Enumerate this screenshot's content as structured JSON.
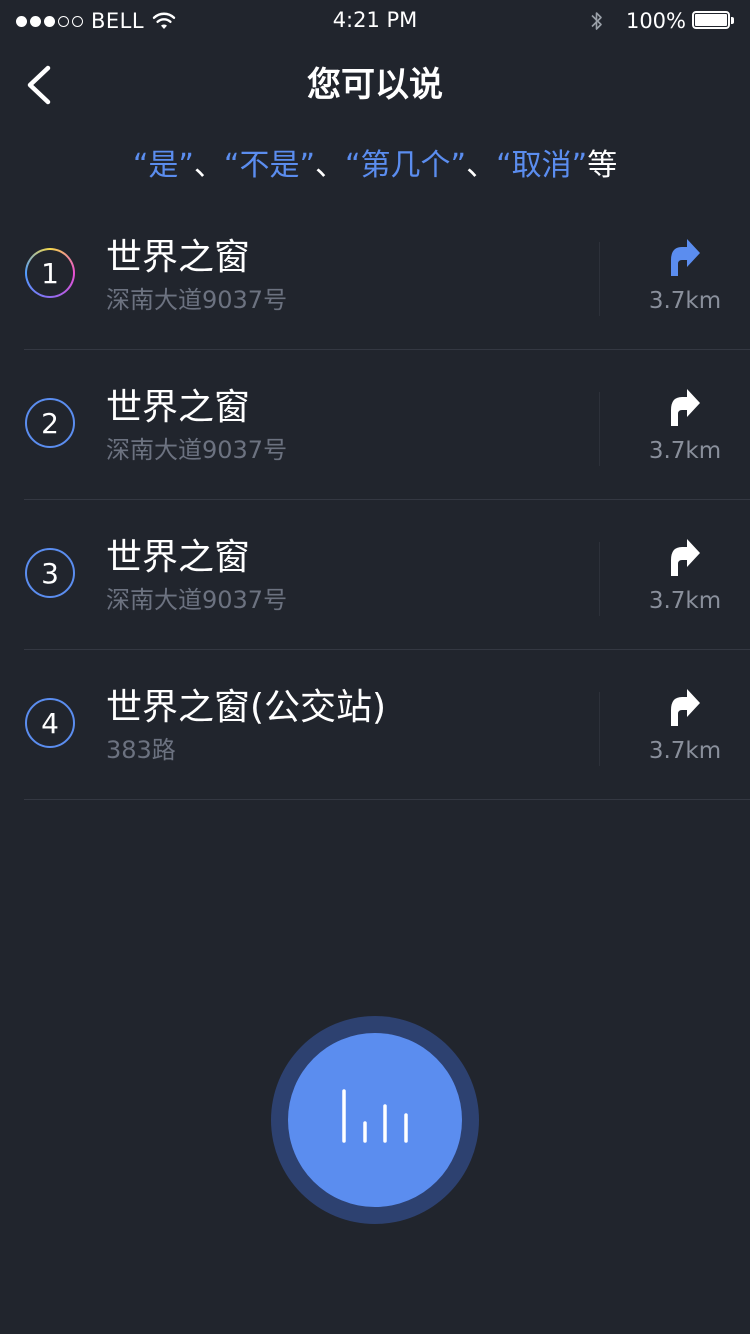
{
  "status_bar": {
    "carrier": "BELL",
    "time": "4:21 PM",
    "battery": "100%"
  },
  "header": {
    "title": "您可以说"
  },
  "hint": {
    "parts": [
      "“是”",
      "、",
      "“不是”",
      "、",
      "“第几个”",
      "、",
      "“取消”",
      "等"
    ]
  },
  "colors": {
    "accent": "#5b8def",
    "background": "#21252d",
    "muted_text": "#6c7280"
  },
  "results": [
    {
      "index": "1",
      "title": "世界之窗",
      "subtitle": "深南大道9037号",
      "distance": "3.7km",
      "icon": "turn-right-icon",
      "highlighted": true
    },
    {
      "index": "2",
      "title": "世界之窗",
      "subtitle": "深南大道9037号",
      "distance": "3.7km",
      "icon": "turn-right-icon",
      "highlighted": false
    },
    {
      "index": "3",
      "title": "世界之窗",
      "subtitle": "深南大道9037号",
      "distance": "3.7km",
      "icon": "turn-right-icon",
      "highlighted": false
    },
    {
      "index": "4",
      "title": "世界之窗(公交站)",
      "subtitle": "383路",
      "distance": "3.7km",
      "icon": "turn-right-icon",
      "highlighted": false
    }
  ],
  "voice_button": {
    "icon": "voice-wave-icon"
  }
}
